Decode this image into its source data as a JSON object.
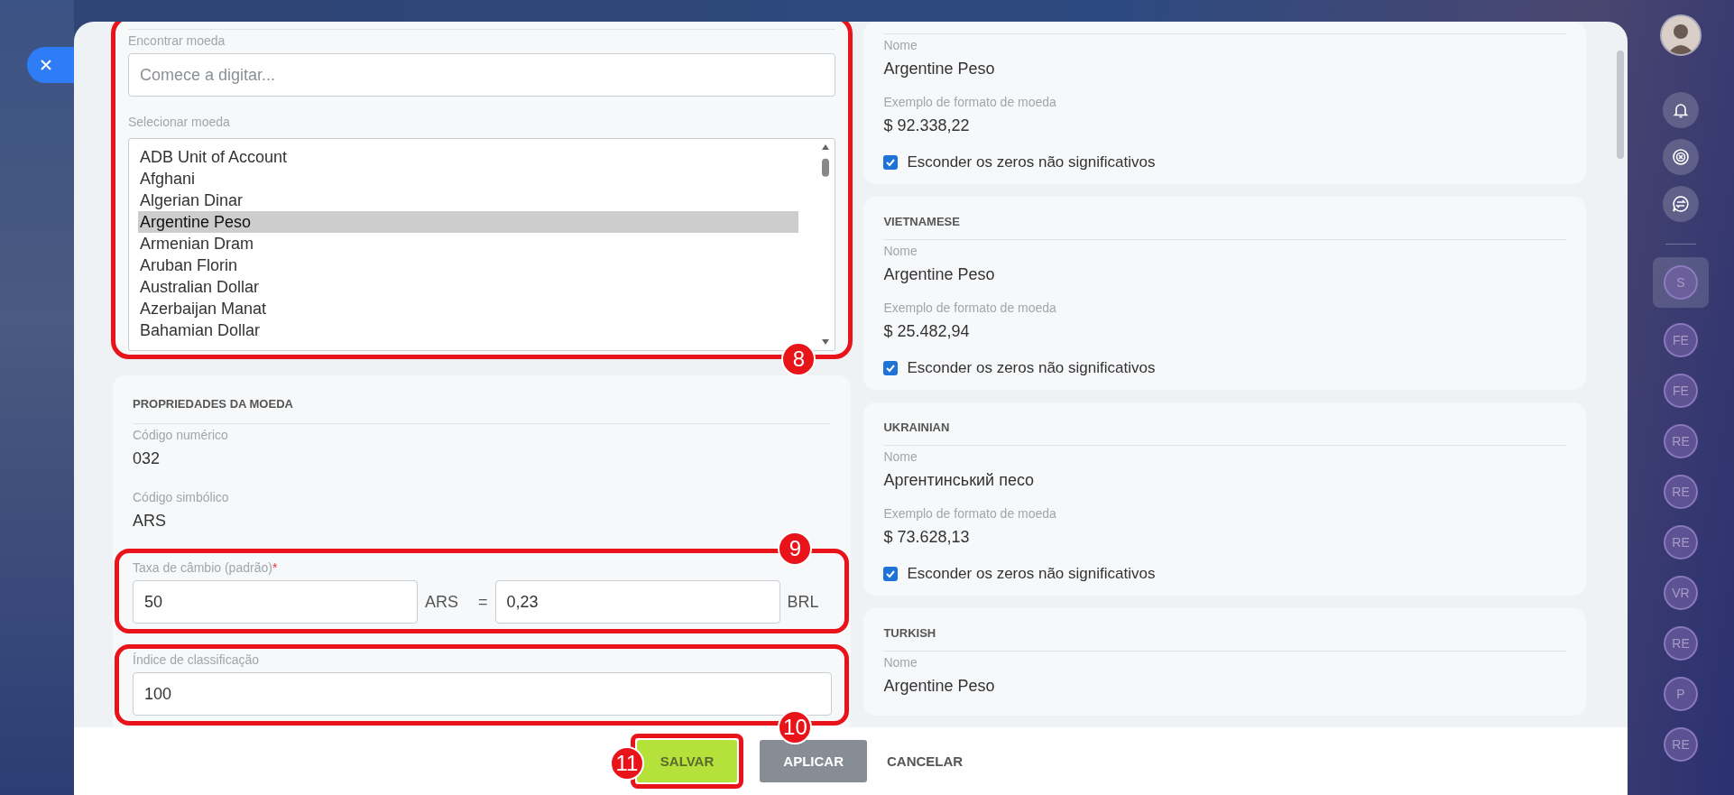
{
  "currency_search": {
    "callout": "8",
    "search": {
      "label": "Encontrar moeda",
      "placeholder": "Comece a digitar..."
    },
    "select": {
      "label": "Selecionar moeda",
      "options": [
        {
          "label": "ADB Unit of Account",
          "selected": false
        },
        {
          "label": "Afghani",
          "selected": false
        },
        {
          "label": "Algerian Dinar",
          "selected": false
        },
        {
          "label": "Argentine Peso",
          "selected": true
        },
        {
          "label": "Armenian Dram",
          "selected": false
        },
        {
          "label": "Aruban Florin",
          "selected": false
        },
        {
          "label": "Australian Dollar",
          "selected": false
        },
        {
          "label": "Azerbaijan Manat",
          "selected": false
        },
        {
          "label": "Bahamian Dollar",
          "selected": false
        }
      ]
    }
  },
  "properties": {
    "title": "PROPRIEDADES DA MOEDA",
    "numeric_code": {
      "label": "Código numérico",
      "value": "032"
    },
    "symbolic_code": {
      "label": "Código simbólico",
      "value": "ARS"
    },
    "exchange_rate": {
      "callout": "9",
      "label": "Taxa de câmbio (padrão)",
      "required_mark": "*",
      "amount": "50",
      "currency": "ARS",
      "equals": "=",
      "rate": "0,23",
      "base_currency": "BRL"
    },
    "sort_index": {
      "callout": "10",
      "label": "Índice de classificação",
      "value": "100"
    }
  },
  "languages": [
    {
      "name_label": "Nome",
      "name": "Argentine Peso",
      "format_label": "Exemplo de formato de moeda",
      "format": "$ 92.338,22",
      "hide_zeros": {
        "label": "Esconder os zeros não significativos",
        "checked": true
      }
    },
    {
      "title": "VIETNAMESE",
      "name_label": "Nome",
      "name": "Argentine Peso",
      "format_label": "Exemplo de formato de moeda",
      "format": "$ 25.482,94",
      "hide_zeros": {
        "label": "Esconder os zeros não significativos",
        "checked": true
      }
    },
    {
      "title": "UKRAINIAN",
      "name_label": "Nome",
      "name": "Аргентинський песо",
      "format_label": "Exemplo de formato de moeda",
      "format": "$ 73.628,13",
      "hide_zeros": {
        "label": "Esconder os zeros não significativos",
        "checked": true
      }
    },
    {
      "title": "TURKISH",
      "name_label": "Nome",
      "name": "Argentine Peso"
    }
  ],
  "footer": {
    "buttons": [
      {
        "label": "SALVAR",
        "kind": "primary",
        "callout": "11"
      },
      {
        "label": "APLICAR",
        "kind": "secondary"
      },
      {
        "label": "CANCELAR",
        "kind": "link"
      }
    ]
  },
  "right_rail": {
    "items": [
      {
        "kind": "avatar"
      },
      {
        "kind": "bell"
      },
      {
        "kind": "copilot"
      },
      {
        "kind": "chat-sync"
      },
      {
        "kind": "divider"
      },
      {
        "kind": "chat",
        "initials": "S",
        "selected": true
      },
      {
        "kind": "chat",
        "initials": "FE",
        "selected": false
      },
      {
        "kind": "chat",
        "initials": "FE",
        "selected": false
      },
      {
        "kind": "chat",
        "initials": "RE",
        "selected": false
      },
      {
        "kind": "chat",
        "initials": "RE",
        "selected": false
      },
      {
        "kind": "chat",
        "initials": "RE",
        "selected": false
      },
      {
        "kind": "chat",
        "initials": "VR",
        "selected": false
      },
      {
        "kind": "chat",
        "initials": "RE",
        "selected": false
      },
      {
        "kind": "chat",
        "initials": "P",
        "selected": false
      },
      {
        "kind": "chat",
        "initials": "RE",
        "selected": false
      }
    ]
  }
}
